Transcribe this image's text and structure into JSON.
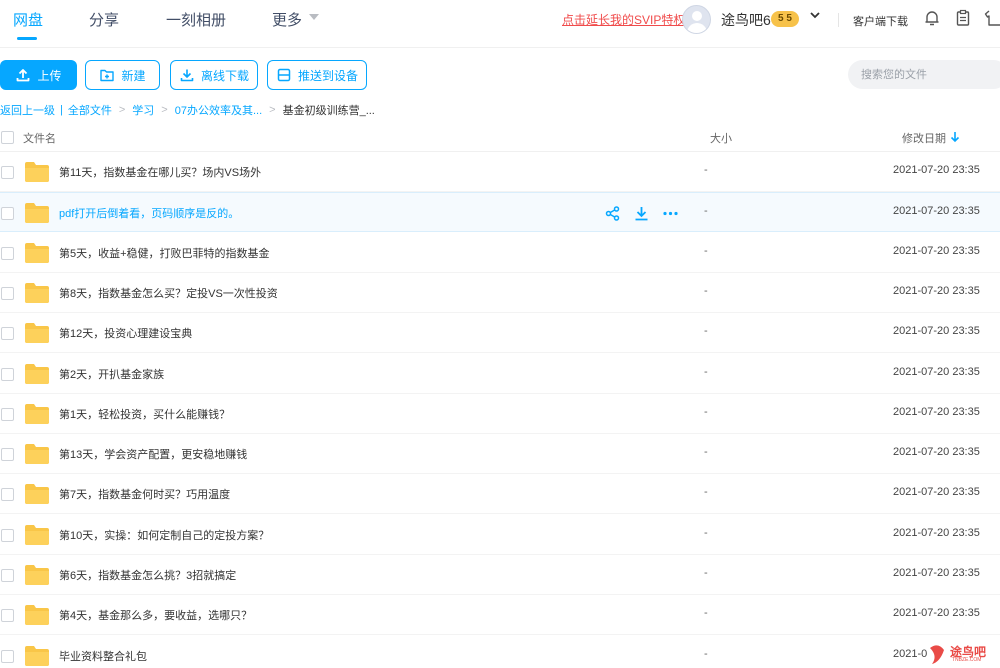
{
  "nav": {
    "tabs": [
      {
        "label": "网盘"
      },
      {
        "label": "分享"
      },
      {
        "label": "一刻相册"
      },
      {
        "label": "更多"
      }
    ],
    "svip_link": "点击延长我的SVIP特权",
    "username": "途鸟吧6",
    "vip_level": "5 5",
    "client_download": "客户端下载"
  },
  "toolbar": {
    "upload": "上传",
    "new": "新建",
    "offline_download": "离线下载",
    "push_to_device": "推送到设备",
    "search_placeholder": "搜索您的文件"
  },
  "breadcrumb": {
    "back": "返回上一级",
    "all_files": "全部文件",
    "items": [
      "学习",
      "07办公效率及其...",
      "基金初级训练营_..."
    ]
  },
  "table": {
    "col_name": "文件名",
    "col_size": "大小",
    "col_date": "修改日期",
    "rows": [
      {
        "name": "第11天，指数基金在哪儿买？场内VS场外",
        "size": "-",
        "date": "2021-07-20 23:35"
      },
      {
        "name": "pdf打开后倒着看，页码顺序是反的。",
        "size": "-",
        "date": "2021-07-20 23:35"
      },
      {
        "name": "第5天，收益+稳健，打败巴菲特的指数基金",
        "size": "-",
        "date": "2021-07-20 23:35"
      },
      {
        "name": "第8天，指数基金怎么买？定投VS一次性投资",
        "size": "-",
        "date": "2021-07-20 23:35"
      },
      {
        "name": "第12天，投资心理建设宝典",
        "size": "-",
        "date": "2021-07-20 23:35"
      },
      {
        "name": "第2天，开扒基金家族",
        "size": "-",
        "date": "2021-07-20 23:35"
      },
      {
        "name": "第1天，轻松投资，买什么能赚钱？",
        "size": "-",
        "date": "2021-07-20 23:35"
      },
      {
        "name": "第13天，学会资产配置，更安稳地赚钱",
        "size": "-",
        "date": "2021-07-20 23:35"
      },
      {
        "name": "第7天，指数基金何时买？巧用温度",
        "size": "-",
        "date": "2021-07-20 23:35"
      },
      {
        "name": "第10天，实操：如何定制自己的定投方案？",
        "size": "-",
        "date": "2021-07-20 23:35"
      },
      {
        "name": "第6天，指数基金怎么挑？3招就搞定",
        "size": "-",
        "date": "2021-07-20 23:35"
      },
      {
        "name": "第4天，基金那么多，要收益，选哪只？",
        "size": "-",
        "date": "2021-07-20 23:35"
      },
      {
        "name": "毕业资料整合礼包",
        "size": "-",
        "date": "2021-0"
      }
    ]
  },
  "watermark": {
    "text": "途鸟吧",
    "sub": "TNBZE.COM"
  }
}
